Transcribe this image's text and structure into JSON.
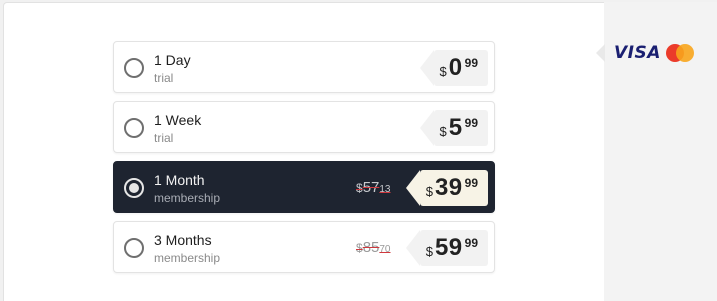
{
  "plans": [
    {
      "name": "1 Day",
      "subtitle": "trial",
      "currency": "$",
      "price": "0",
      "cents": "99",
      "old_currency": "",
      "old_price": "",
      "old_cents": "",
      "selected": false
    },
    {
      "name": "1 Week",
      "subtitle": "trial",
      "currency": "$",
      "price": "5",
      "cents": "99",
      "old_currency": "",
      "old_price": "",
      "old_cents": "",
      "selected": false
    },
    {
      "name": "1 Month",
      "subtitle": "membership",
      "currency": "$",
      "price": "39",
      "cents": "99",
      "old_currency": "$",
      "old_price": "57",
      "old_cents": "13",
      "selected": true
    },
    {
      "name": "3 Months",
      "subtitle": "membership",
      "currency": "$",
      "price": "59",
      "cents": "99",
      "old_currency": "$",
      "old_price": "85",
      "old_cents": "70",
      "selected": false
    }
  ],
  "payment": {
    "visa_label": "VISA",
    "visa_color": "#1a1f71",
    "mastercard_icon": "mastercard-icon"
  },
  "colors": {
    "selected_bg": "#1e2430",
    "strike": "#d0383e",
    "selected_tag": "#f7f3e6"
  }
}
